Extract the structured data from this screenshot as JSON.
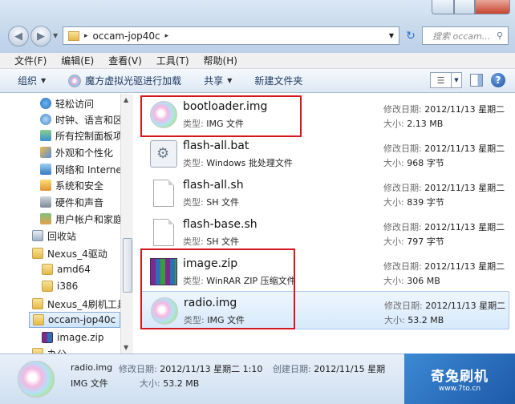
{
  "address": {
    "path": "occam-jop40c"
  },
  "search": {
    "placeholder": "搜索 occam..."
  },
  "menu": [
    "文件(F)",
    "编辑(E)",
    "查看(V)",
    "工具(T)",
    "帮助(H)"
  ],
  "toolbar": {
    "organize": "组织",
    "mount": "魔方虚拟光驱进行加载",
    "share": "共享",
    "new_folder": "新建文件夹"
  },
  "nav": [
    {
      "label": "轻松访问",
      "icon": "accessibility-icon"
    },
    {
      "label": "时钟、语言和区",
      "icon": "clock-globe-icon"
    },
    {
      "label": "所有控制面板项",
      "icon": "control-panel-icon"
    },
    {
      "label": "外观和个性化",
      "icon": "appearance-icon"
    },
    {
      "label": "网络和 Internet",
      "icon": "network-icon"
    },
    {
      "label": "系统和安全",
      "icon": "system-security-icon"
    },
    {
      "label": "硬件和声音",
      "icon": "hardware-sound-icon"
    },
    {
      "label": "用户帐户和家庭",
      "icon": "user-accounts-icon"
    },
    {
      "label": "回收站",
      "icon": "recycle-bin-icon"
    },
    {
      "label": "Nexus_4驱动",
      "icon": "folder-icon"
    },
    {
      "label": "amd64",
      "icon": "folder-icon"
    },
    {
      "label": "i386",
      "icon": "folder-icon"
    },
    {
      "label": "Nexus_4刷机工具",
      "icon": "folder-icon"
    },
    {
      "label": "occam-jop40c",
      "icon": "folder-icon"
    },
    {
      "label": "image.zip",
      "icon": "zip-icon"
    },
    {
      "label": "办公",
      "icon": "folder-icon"
    }
  ],
  "files": [
    {
      "name": "bootloader.img",
      "type_label": "类型:",
      "type": "IMG 文件",
      "date_label": "修改日期:",
      "date": "2012/11/13 星期二",
      "size_label": "大小:",
      "size": "2.13 MB",
      "icon": "disc-image-icon"
    },
    {
      "name": "flash-all.bat",
      "type_label": "类型:",
      "type": "Windows 批处理文件",
      "date_label": "修改日期:",
      "date": "2012/11/13 星期二",
      "size_label": "大小:",
      "size": "968 字节",
      "icon": "batch-file-icon"
    },
    {
      "name": "flash-all.sh",
      "type_label": "类型:",
      "type": "SH 文件",
      "date_label": "修改日期:",
      "date": "2012/11/13 星期二",
      "size_label": "大小:",
      "size": "839 字节",
      "icon": "document-icon"
    },
    {
      "name": "flash-base.sh",
      "type_label": "类型:",
      "type": "SH 文件",
      "date_label": "修改日期:",
      "date": "2012/11/13 星期二",
      "size_label": "大小:",
      "size": "797 字节",
      "icon": "document-icon"
    },
    {
      "name": "image.zip",
      "type_label": "类型:",
      "type": "WinRAR ZIP 压缩文件",
      "date_label": "修改日期:",
      "date": "2012/11/13 星期二",
      "size_label": "大小:",
      "size": "306 MB",
      "icon": "winrar-archive-icon"
    },
    {
      "name": "radio.img",
      "type_label": "类型:",
      "type": "IMG 文件",
      "date_label": "修改日期:",
      "date": "2012/11/13 星期二",
      "size_label": "大小:",
      "size": "53.2 MB",
      "icon": "disc-image-icon"
    }
  ],
  "details": {
    "name": "radio.img",
    "type": "IMG 文件",
    "modified_label": "修改日期:",
    "modified": "2012/11/13 星期二 1:10",
    "created_label": "创建日期:",
    "created": "2012/11/15 星期",
    "size_label": "大小:",
    "size": "53.2 MB"
  },
  "watermark": {
    "title": "奇兔刷机",
    "url": "www.7to.cn"
  }
}
